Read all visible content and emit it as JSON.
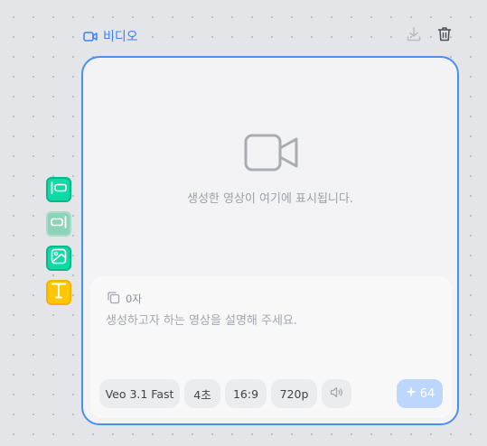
{
  "node": {
    "title": "비디오",
    "title_icon": "video-camera-icon",
    "accent_color": "#3b82f6",
    "download_icon": "download-icon",
    "delete_icon": "trash-icon"
  },
  "preview": {
    "icon": "video-camera-icon",
    "message": "생성한 영상이 여기에 표시됩니다."
  },
  "prompt": {
    "copy_icon": "copy-icon",
    "char_count": "0자",
    "value": "",
    "placeholder": "생성하고자 하는 영상을 설명해 주세요."
  },
  "options": {
    "model": "Veo 3.1 Fast",
    "duration": "4초",
    "aspect_ratio": "16:9",
    "resolution": "720p",
    "sound_icon": "speaker-icon"
  },
  "generate": {
    "icon": "sparkle-icon",
    "credits": "64",
    "color": "#bcd7fb"
  },
  "side_tools": [
    {
      "icon": "align-left-icon",
      "color": "#10d9a6"
    },
    {
      "icon": "align-right-icon",
      "color": "#8dd3b9"
    },
    {
      "icon": "image-icon",
      "color": "#10d9a6"
    },
    {
      "icon": "text-icon",
      "color": "#ffc700"
    }
  ]
}
